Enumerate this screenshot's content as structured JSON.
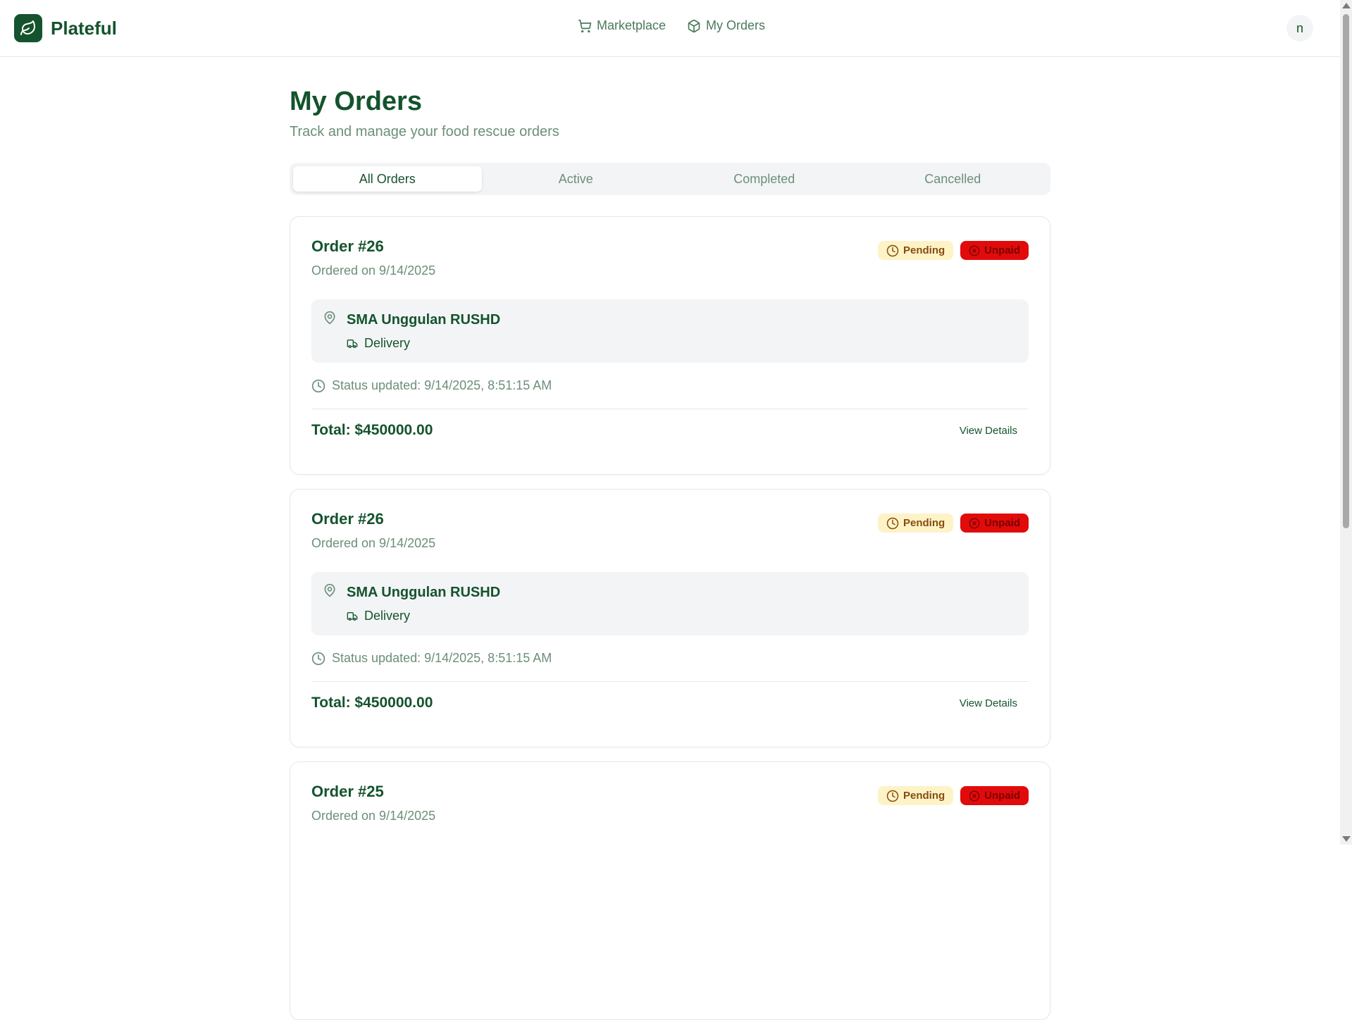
{
  "brand": {
    "name": "Plateful",
    "logo_icon": "leaf-icon"
  },
  "nav": [
    {
      "label": "Marketplace",
      "icon": "cart-icon"
    },
    {
      "label": "My Orders",
      "icon": "package-icon"
    }
  ],
  "user": {
    "avatar_letter": "n"
  },
  "page": {
    "title": "My Orders",
    "subtitle": "Track and manage your food rescue orders"
  },
  "tabs": [
    {
      "label": "All Orders",
      "active": true
    },
    {
      "label": "Active",
      "active": false
    },
    {
      "label": "Completed",
      "active": false
    },
    {
      "label": "Cancelled",
      "active": false
    }
  ],
  "orders": [
    {
      "title": "Order #26",
      "date": "Ordered on 9/14/2025",
      "status": "Pending",
      "payment": "Unpaid",
      "location": "SMA Unggulan RUSHD",
      "method": "Delivery",
      "status_updated": "Status updated: 9/14/2025, 8:51:15 AM",
      "total": "Total: $450000.00",
      "action": "View Details"
    },
    {
      "title": "Order #26",
      "date": "Ordered on 9/14/2025",
      "status": "Pending",
      "payment": "Unpaid",
      "location": "SMA Unggulan RUSHD",
      "method": "Delivery",
      "status_updated": "Status updated: 9/14/2025, 8:51:15 AM",
      "total": "Total: $450000.00",
      "action": "View Details"
    },
    {
      "title": "Order #25",
      "date": "Ordered on 9/14/2025",
      "status": "Pending",
      "payment": "Unpaid"
    }
  ],
  "colors": {
    "primary": "#14532d",
    "muted": "#6b8f78",
    "pending_bg": "#fef3c7",
    "unpaid_bg": "#e10b0b"
  }
}
